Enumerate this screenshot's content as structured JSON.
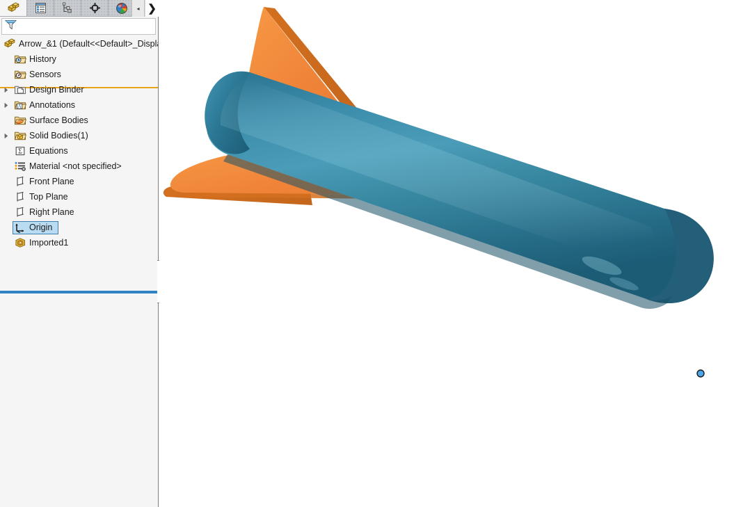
{
  "app": {
    "name": "SolidWorks FeatureManager",
    "accent_orange": "#e8a317",
    "accent_blue": "#2f83c5",
    "selection_fill": "#b9dcf3",
    "selection_border": "#3e7fb0",
    "panel_bg": "#f5f5f5",
    "viewport_bg": "#ffffff"
  },
  "tabs": [
    {
      "id": "feature-manager",
      "icon": "yellow-blocks-icon",
      "title": "FeatureManager Design Tree",
      "active": true
    },
    {
      "id": "property-manager",
      "icon": "property-list-icon",
      "title": "PropertyManager",
      "active": false
    },
    {
      "id": "configuration-manager",
      "icon": "configuration-tree-icon",
      "title": "ConfigurationManager",
      "active": false
    },
    {
      "id": "dimxpert-manager",
      "icon": "crosshair-target-icon",
      "title": "DimXpertManager",
      "active": false
    },
    {
      "id": "display-manager",
      "icon": "color-sphere-icon",
      "title": "DisplayManager",
      "active": false
    }
  ],
  "tab_nav": {
    "prev_label": "◂",
    "next_label": "❯"
  },
  "filter": {
    "icon": "funnel-filter-icon",
    "value": "",
    "placeholder": ""
  },
  "tree": {
    "root": {
      "icon": "yellow-blocks-icon",
      "label": "Arrow_&1  (Default<<Default>_Displa"
    },
    "items": [
      {
        "label": "History",
        "icon": "history-folder-icon",
        "indent": 1,
        "expandable": false,
        "selected": false
      },
      {
        "label": "Sensors",
        "icon": "sensors-folder-icon",
        "indent": 1,
        "expandable": false,
        "selected": false
      },
      {
        "label": "Design Binder",
        "icon": "design-binder-icon",
        "indent": 1,
        "expandable": true,
        "selected": false
      },
      {
        "label": "Annotations",
        "icon": "annotations-folder-icon",
        "indent": 1,
        "expandable": true,
        "selected": false
      },
      {
        "label": "Surface Bodies",
        "icon": "surface-bodies-icon",
        "indent": 1,
        "expandable": false,
        "selected": false
      },
      {
        "label": "Solid Bodies(1)",
        "icon": "solid-bodies-icon",
        "indent": 1,
        "expandable": true,
        "selected": false
      },
      {
        "label": "Equations",
        "icon": "equations-icon",
        "indent": 1,
        "expandable": false,
        "selected": false
      },
      {
        "label": "Material <not specified>",
        "icon": "material-icon",
        "indent": 1,
        "expandable": false,
        "selected": false
      },
      {
        "label": "Front Plane",
        "icon": "plane-icon",
        "indent": 1,
        "expandable": false,
        "selected": false
      },
      {
        "label": "Top Plane",
        "icon": "plane-icon",
        "indent": 1,
        "expandable": false,
        "selected": false
      },
      {
        "label": "Right Plane",
        "icon": "plane-icon",
        "indent": 1,
        "expandable": false,
        "selected": false
      },
      {
        "label": "Origin",
        "icon": "origin-axes-icon",
        "indent": 1,
        "expandable": false,
        "selected": true
      },
      {
        "label": "Imported1",
        "icon": "imported-body-icon",
        "indent": 1,
        "expandable": false,
        "selected": false
      }
    ]
  },
  "rollback": {
    "name": "rollback-bar"
  },
  "splitter": {
    "name": "panel-splitter-handle"
  },
  "model": {
    "name": "rocket-arrow-3d-model",
    "body_color_light": "#3d8fae",
    "body_color_mid": "#2e7c9b",
    "body_color_dark": "#23637d",
    "fin_color_light": "#f5923e",
    "fin_color_mid": "#ef8133",
    "fin_color_dark": "#cf6d26",
    "origin_point_color": "#4da6e8",
    "description": "Shaded isometric view of an arrow/rocket: rounded teal cylindrical body running lower-right with two orange swept fins near the upper-left end"
  }
}
